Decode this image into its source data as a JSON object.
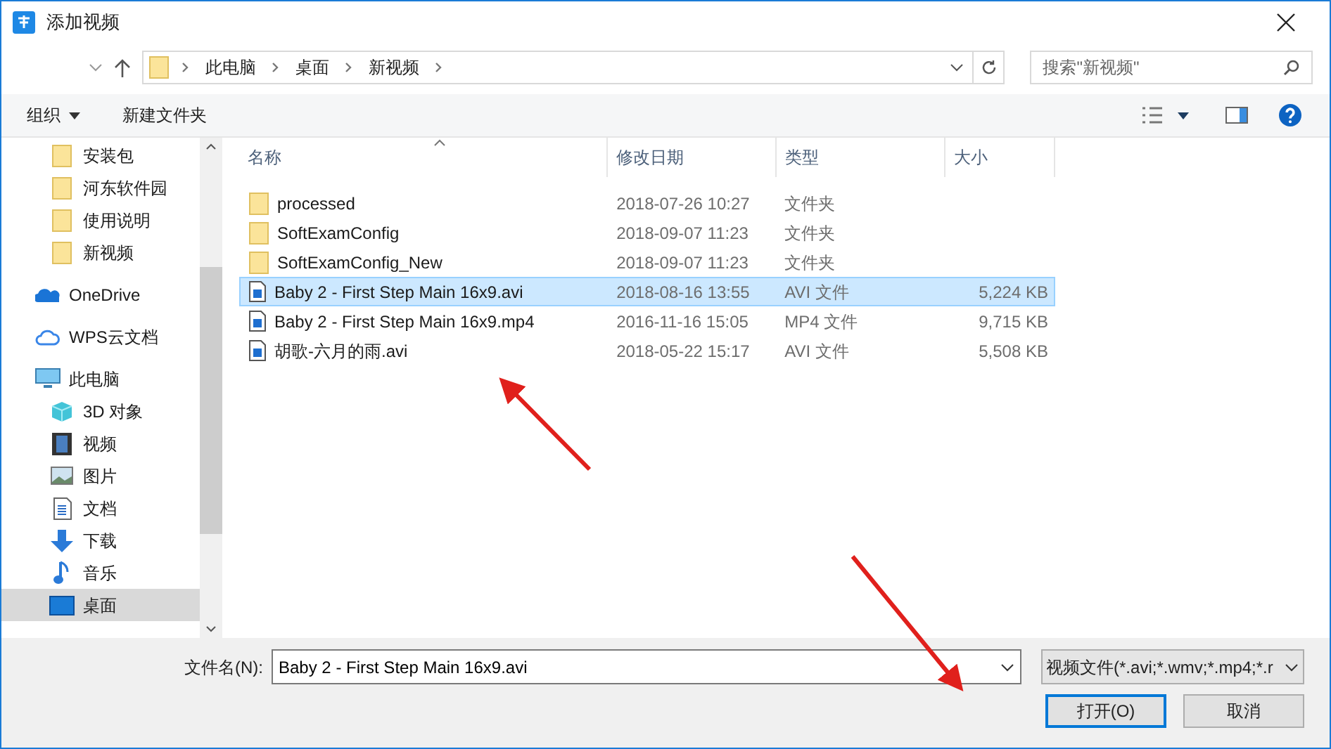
{
  "window": {
    "title": "添加视频"
  },
  "address": {
    "path": [
      "此电脑",
      "桌面",
      "新视频"
    ],
    "search_placeholder": "搜索\"新视频\""
  },
  "toolbar": {
    "organize": "组织",
    "new_folder": "新建文件夹"
  },
  "sidebar": {
    "items": [
      {
        "label": "安装包",
        "kind": "folder",
        "selected": false
      },
      {
        "label": "河东软件园",
        "kind": "folder",
        "selected": false
      },
      {
        "label": "使用说明",
        "kind": "folder",
        "selected": false
      },
      {
        "label": "新视频",
        "kind": "folder",
        "selected": false
      },
      {
        "label": "OneDrive",
        "kind": "onedrive",
        "selected": false
      },
      {
        "label": "WPS云文档",
        "kind": "cloud",
        "selected": false
      },
      {
        "label": "此电脑",
        "kind": "pc",
        "selected": false,
        "children": [
          {
            "label": "3D 对象",
            "kind": "cube",
            "selected": false
          },
          {
            "label": "视频",
            "kind": "video",
            "selected": false
          },
          {
            "label": "图片",
            "kind": "picture",
            "selected": false
          },
          {
            "label": "文档",
            "kind": "document",
            "selected": false
          },
          {
            "label": "下载",
            "kind": "download",
            "selected": false
          },
          {
            "label": "音乐",
            "kind": "music",
            "selected": false
          },
          {
            "label": "桌面",
            "kind": "desktop",
            "selected": true
          }
        ]
      }
    ]
  },
  "table": {
    "columns": [
      "名称",
      "修改日期",
      "类型",
      "大小"
    ],
    "rows": [
      {
        "kind": "folder",
        "name": "processed",
        "date": "2018-07-26 10:27",
        "type": "文件夹",
        "selected": false
      },
      {
        "kind": "folder",
        "name": "SoftExamConfig",
        "date": "2018-09-07 11:23",
        "type": "文件夹",
        "selected": false
      },
      {
        "kind": "folder",
        "name": "SoftExamConfig_New",
        "date": "2018-09-07 11:23",
        "type": "文件夹",
        "selected": false
      },
      {
        "kind": "file",
        "name": "Baby 2 - First Step Main 16x9.avi",
        "date": "2018-08-16 13:55",
        "type": "AVI 文件",
        "size": "5,224 KB",
        "selected": true
      },
      {
        "kind": "file",
        "name": "Baby 2 - First Step Main 16x9.mp4",
        "date": "2016-11-16 15:05",
        "type": "MP4 文件",
        "size": "9,715 KB",
        "selected": false
      },
      {
        "kind": "file",
        "name": "胡歌-六月的雨.avi",
        "date": "2018-05-22 15:17",
        "type": "AVI 文件",
        "size": "5,508 KB",
        "selected": false
      }
    ]
  },
  "footer": {
    "filename_label": "文件名(N):",
    "filename": "Baby 2 - First Step Main 16x9.avi",
    "filter": "视频文件(*.avi;*.wmv;*.mp4;*.r",
    "open": "打开(O)",
    "cancel": "取消"
  }
}
